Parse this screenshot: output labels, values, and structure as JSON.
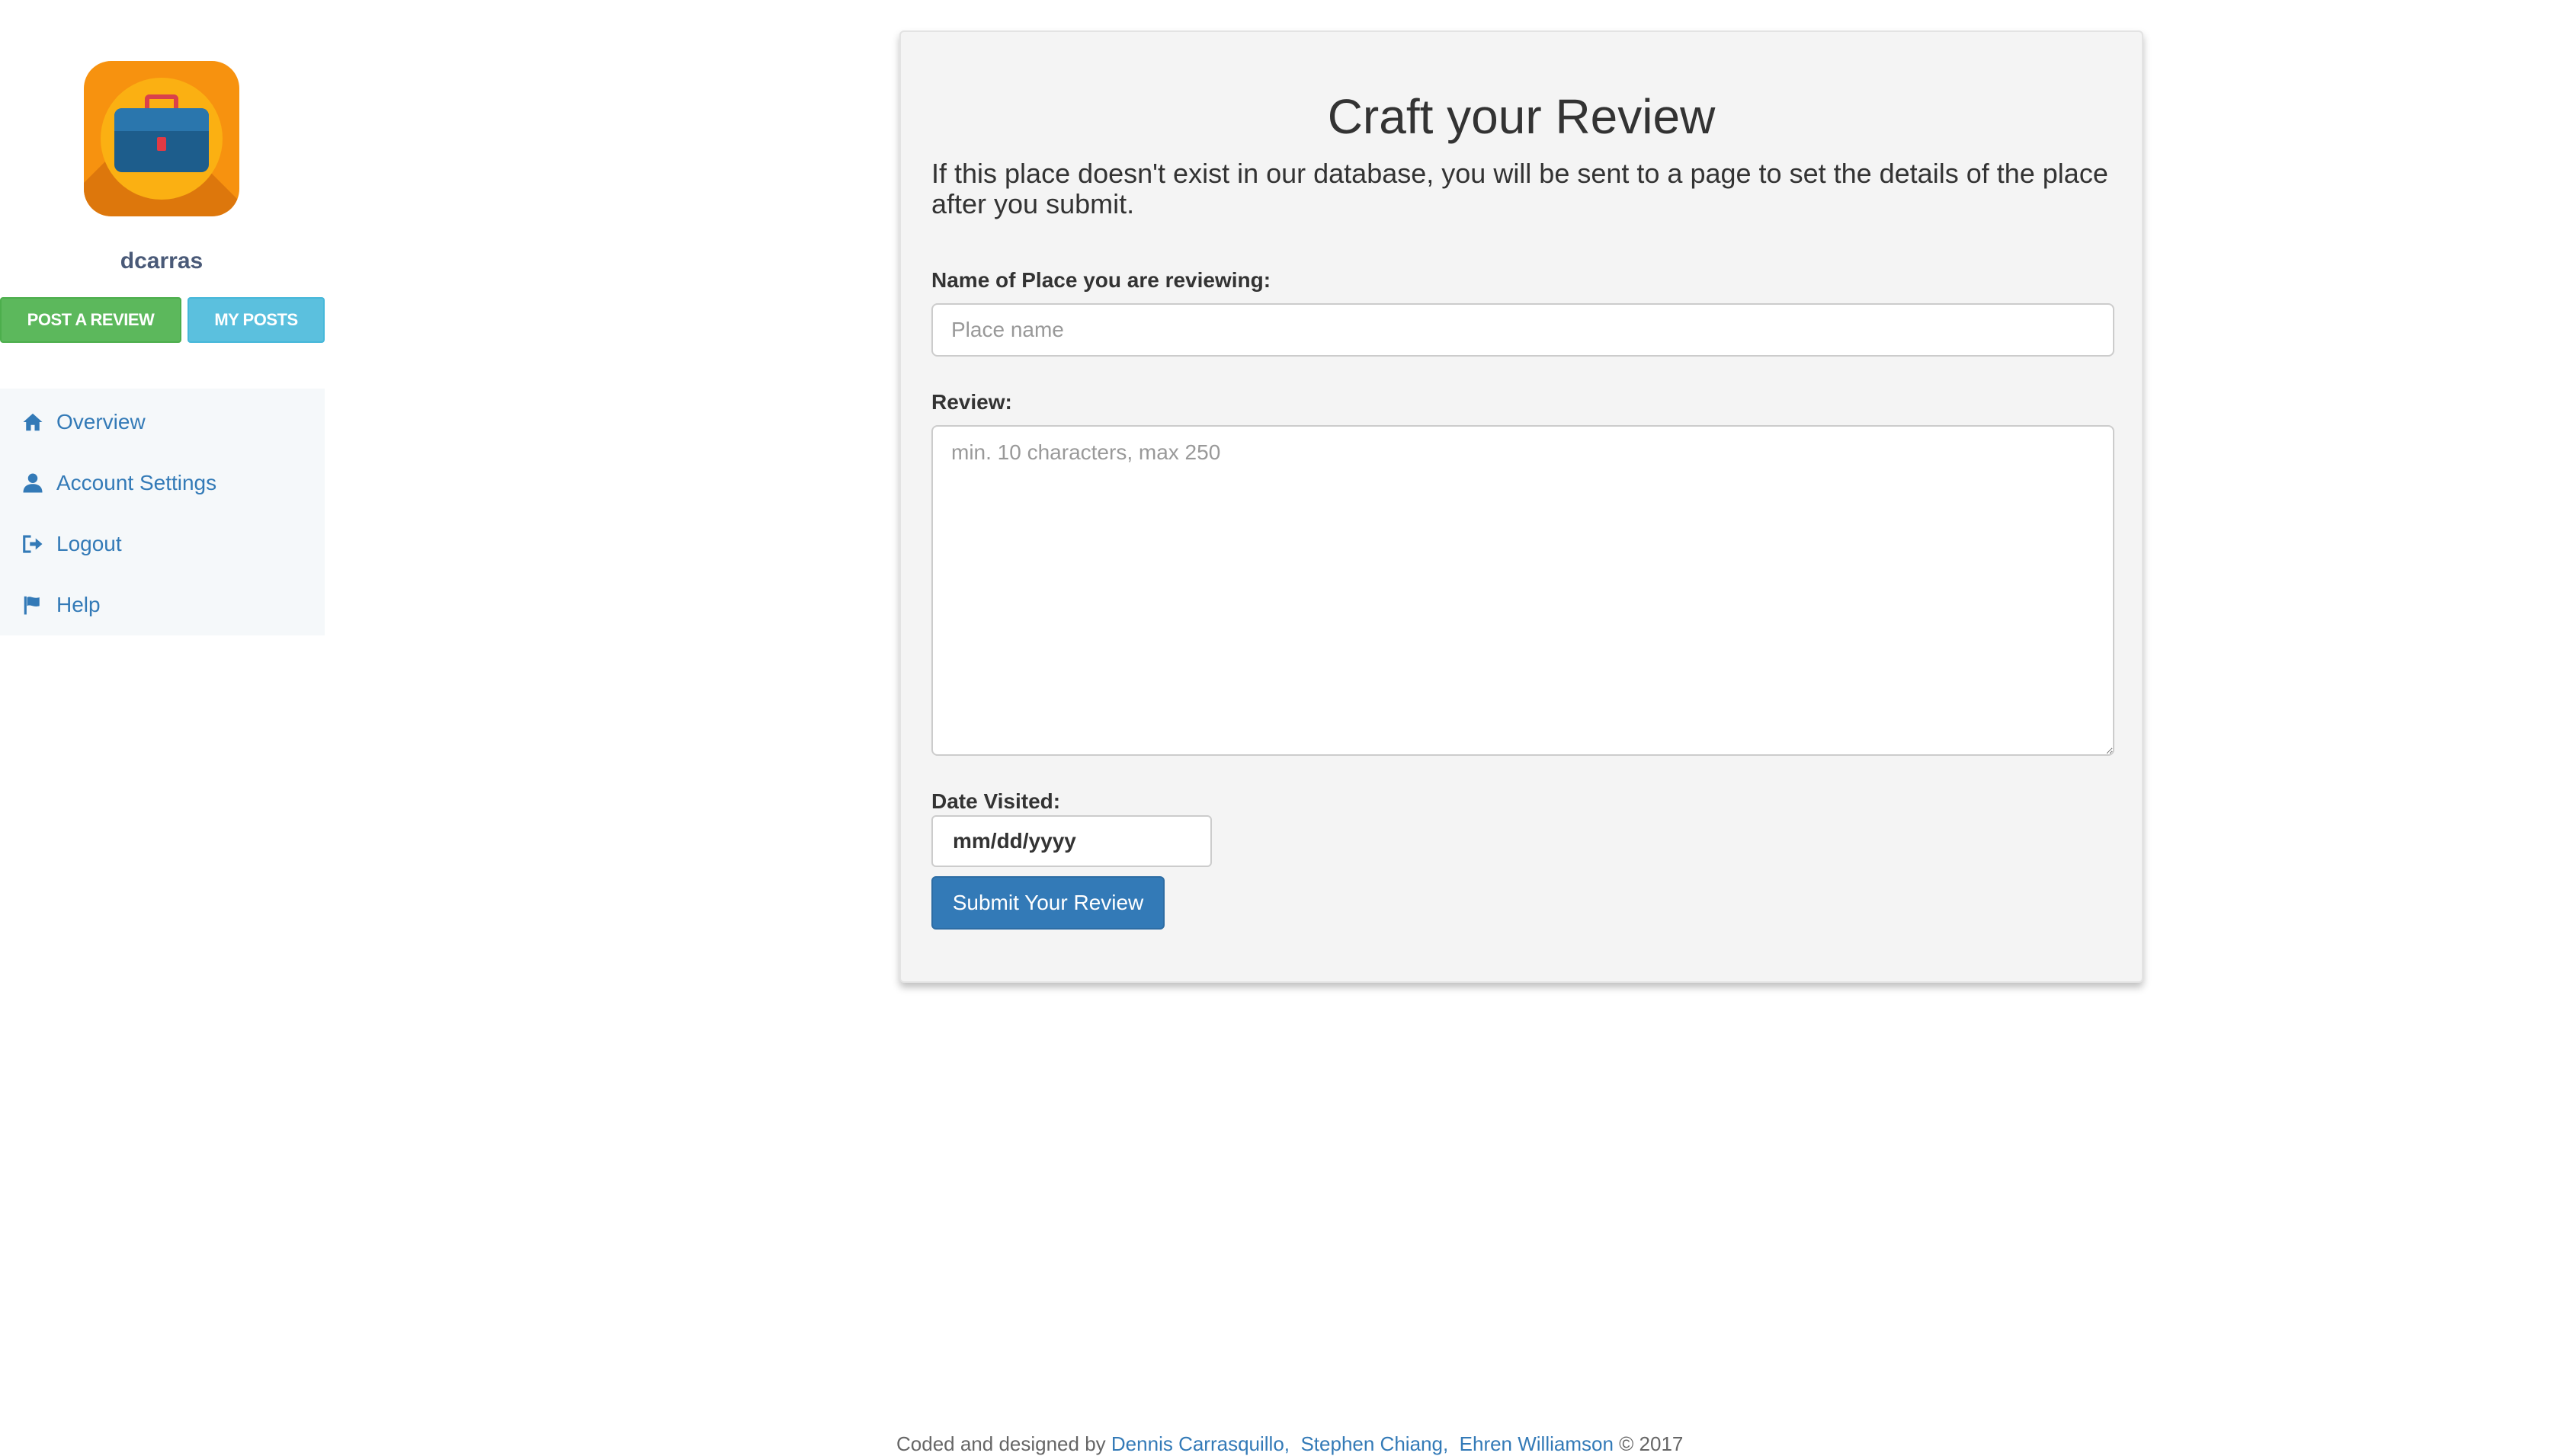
{
  "sidebar": {
    "username": "dcarras",
    "post_button": "POST A REVIEW",
    "myposts_button": "MY POSTS",
    "items": [
      {
        "label": "Overview",
        "icon": "home-icon"
      },
      {
        "label": "Account Settings",
        "icon": "user-icon"
      },
      {
        "label": "Logout",
        "icon": "logout-icon"
      },
      {
        "label": "Help",
        "icon": "flag-icon"
      }
    ]
  },
  "form": {
    "title": "Craft your Review",
    "subtitle": "If this place doesn't exist in our database, you will be sent to a page to set the details of the place after you submit.",
    "place_label": "Name of Place you are reviewing:",
    "place_placeholder": "Place name",
    "review_label": "Review:",
    "review_placeholder": "min. 10 characters, max 250",
    "date_label": "Date Visited:",
    "date_placeholder": "mm/dd/yyyy",
    "submit_label": "Submit Your Review"
  },
  "footer": {
    "prefix": "Coded and designed by",
    "authors": [
      "Dennis Carrasquillo,",
      "Stephen Chiang,",
      "Ehren Williamson"
    ],
    "suffix": "© 2017"
  },
  "colors": {
    "accent": "#337ab7",
    "success": "#5cb85c",
    "info": "#5bc0de"
  }
}
